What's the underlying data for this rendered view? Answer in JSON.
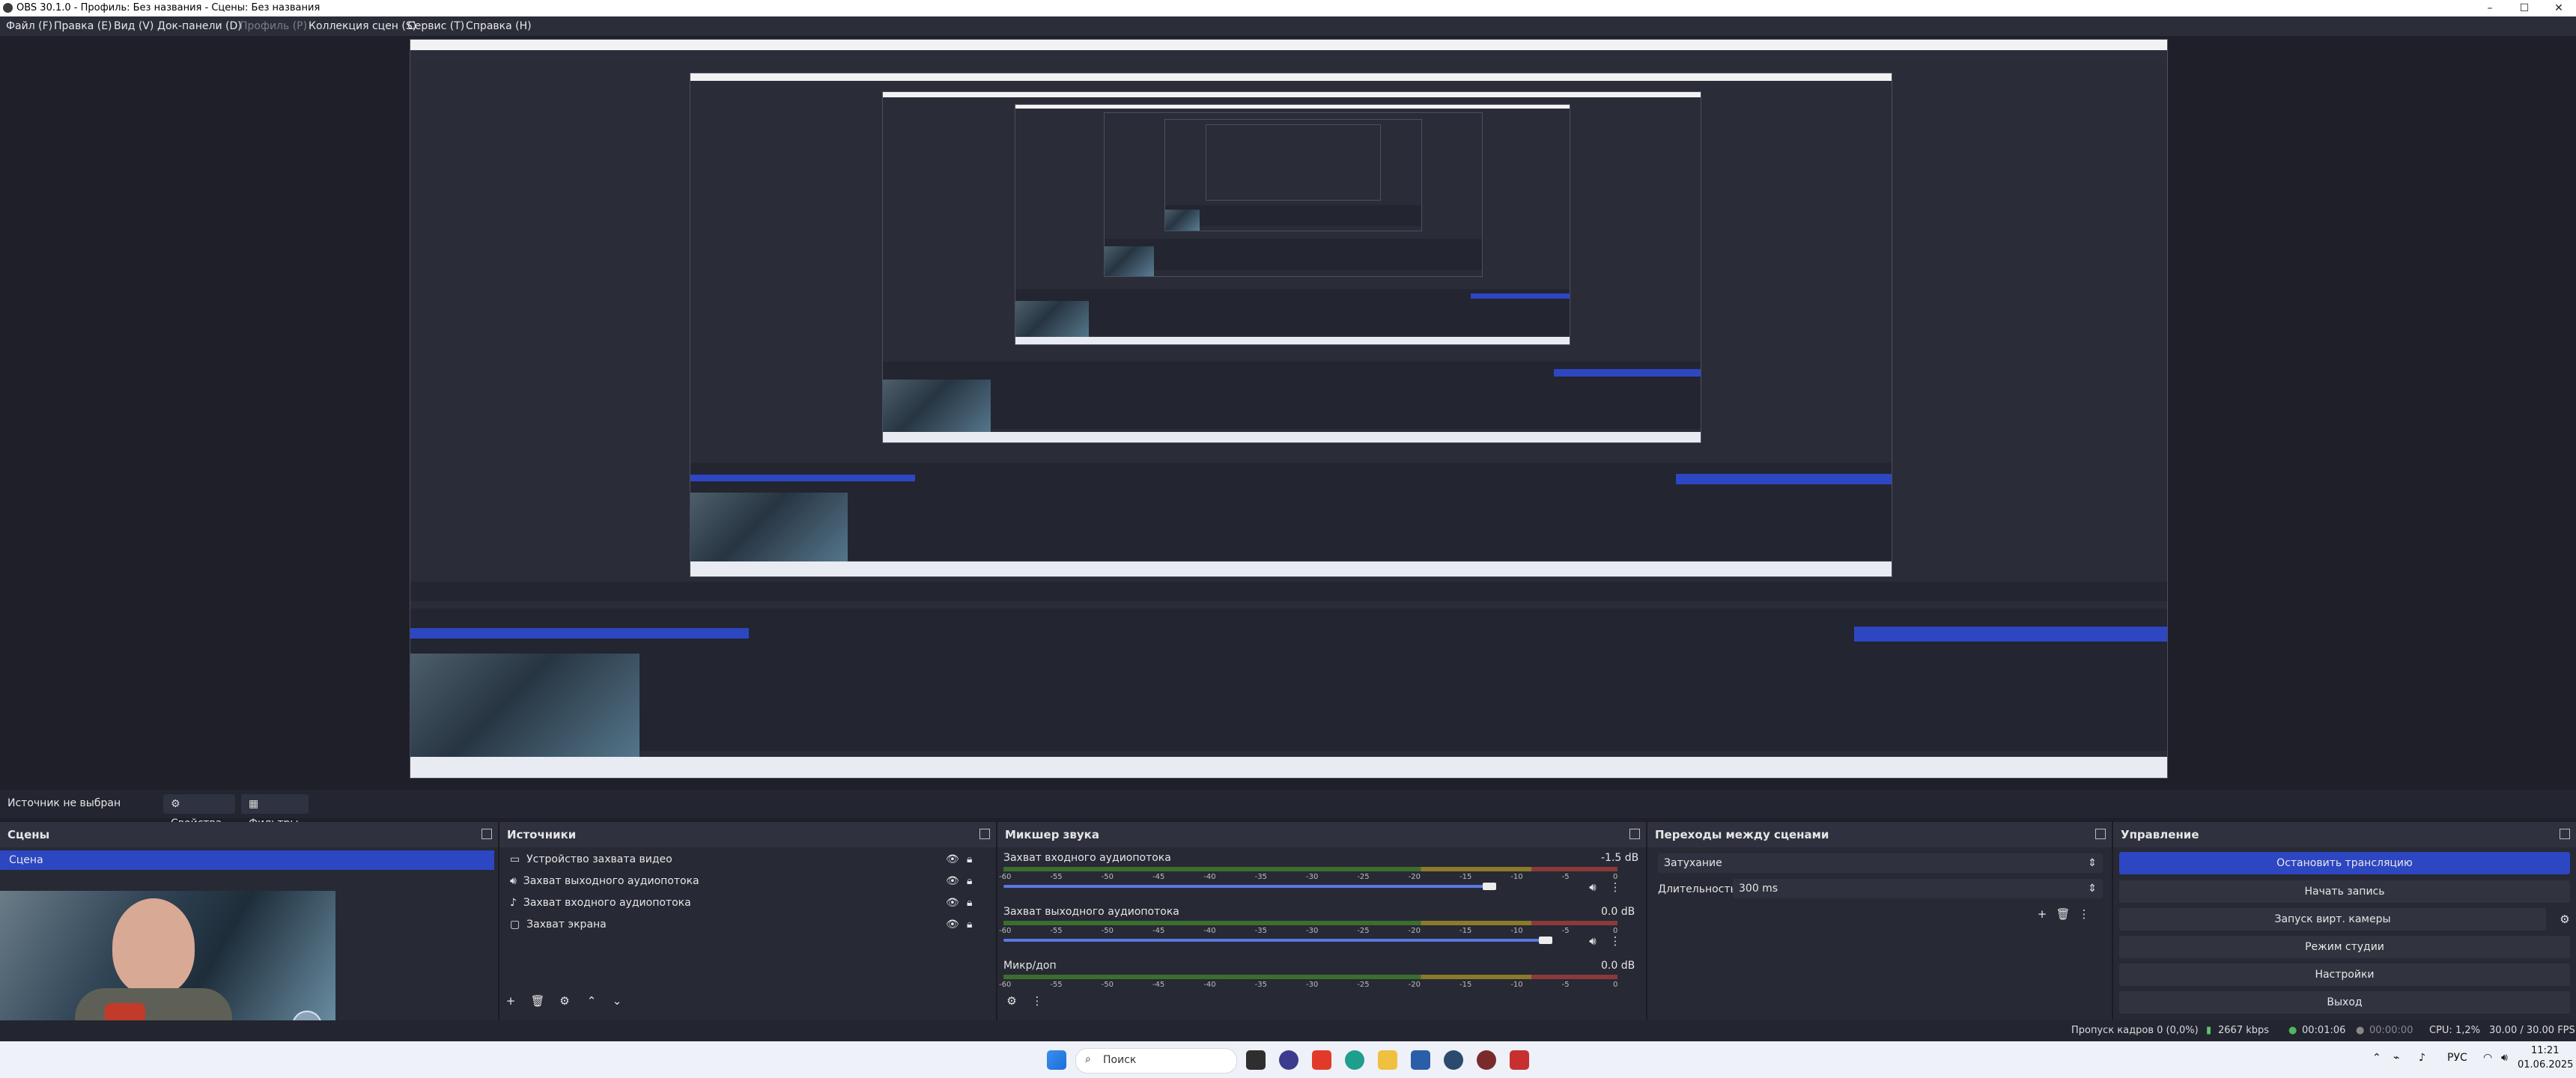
{
  "window": {
    "title": "OBS 30.1.0 - Профиль: Без названия - Сцены: Без названия",
    "minimize": "–",
    "maximize": "☐",
    "close": "✕"
  },
  "menu": {
    "items": [
      {
        "label": "Файл (F)",
        "disabled": false
      },
      {
        "label": "Правка (E)",
        "disabled": false
      },
      {
        "label": "Вид (V)",
        "disabled": false
      },
      {
        "label": "Док-панели (D)",
        "disabled": false
      },
      {
        "label": "Профиль (P)",
        "disabled": true
      },
      {
        "label": "Коллекция сцен (S)",
        "disabled": false
      },
      {
        "label": "Сервис (T)",
        "disabled": false
      },
      {
        "label": "Справка (H)",
        "disabled": false
      }
    ]
  },
  "source_bar": {
    "no_source": "Источник не выбран",
    "properties": "Свойства",
    "filters": "Фильтры"
  },
  "scenes": {
    "title": "Сцены",
    "items": [
      "Сцена"
    ]
  },
  "sources": {
    "title": "Источники",
    "items": [
      {
        "label": "Устройство захвата видео",
        "icon": "camera-icon"
      },
      {
        "label": "Захват выходного аудиопотока",
        "icon": "speaker-icon"
      },
      {
        "label": "Захват входного аудиопотока",
        "icon": "microphone-icon"
      },
      {
        "label": "Захват экрана",
        "icon": "monitor-icon"
      }
    ]
  },
  "mixer": {
    "title": "Микшер звука",
    "scale": [
      "-60",
      "-55",
      "-50",
      "-45",
      "-40",
      "-35",
      "-30",
      "-25",
      "-20",
      "-15",
      "-10",
      "-5",
      "0"
    ],
    "channels": [
      {
        "name": "Захват входного аудиопотока",
        "db": "-1.5 dB",
        "level": 0.86
      },
      {
        "name": "Захват выходного аудиопотока",
        "db": "0.0 dB",
        "level": 0.96
      },
      {
        "name": "Микр/доп",
        "db": "0.0 dB",
        "level": 0.96
      }
    ]
  },
  "transitions": {
    "title": "Переходы между сценами",
    "selected": "Затухание",
    "duration_label": "Длительность",
    "duration_value": "300 ms"
  },
  "controls": {
    "title": "Управление",
    "stop_stream": "Остановить трансляцию",
    "start_record": "Начать запись",
    "virtual_cam": "Запуск вирт. камеры",
    "studio_mode": "Режим студии",
    "settings": "Настройки",
    "exit": "Выход"
  },
  "status": {
    "dropped": "Пропуск кадров 0 (0,0%)",
    "bitrate": "2667 kbps",
    "stream_time": "00:01:06",
    "rec_time": "00:00:00",
    "cpu": "CPU: 1,2%",
    "fps": "30.00 / 30.00 FPS"
  },
  "taskbar": {
    "search_placeholder": "Поиск",
    "lang": "РУС",
    "time": "11:21",
    "date": "01.06.2025"
  },
  "colors": {
    "accent": "#2d46c2",
    "background": "#1e1f29",
    "panel": "#272934"
  }
}
